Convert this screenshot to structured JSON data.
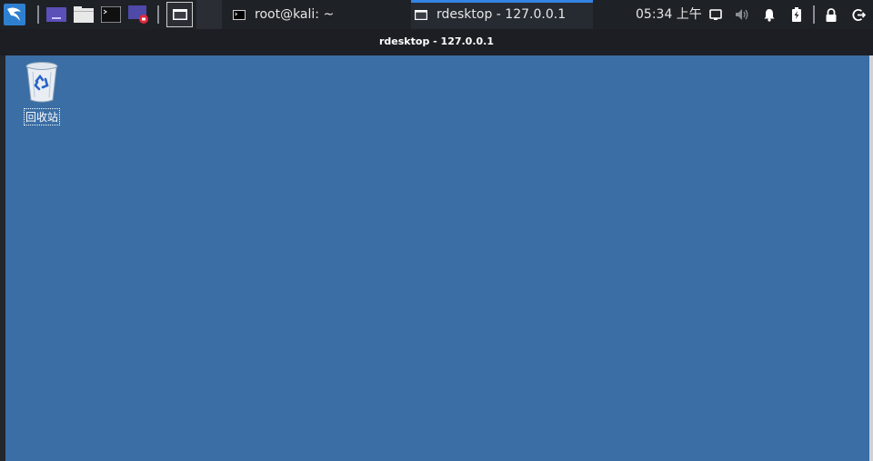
{
  "panel": {
    "launchers": [
      "kali-menu-icon",
      "workspace-icon",
      "file-manager-icon",
      "terminal-icon",
      "screen-recorder-icon",
      "show-desktop-icon"
    ],
    "tasks": [
      {
        "label": "root@kali: ~",
        "active": false
      },
      {
        "label": "rdesktop - 127.0.0.1",
        "active": true
      }
    ],
    "clock": "05:34 上午",
    "tray": [
      "display-icon",
      "volume-icon",
      "bell-icon",
      "battery-icon",
      "lock-icon",
      "logout-icon"
    ],
    "accent": "#3584e4"
  },
  "window": {
    "title": "rdesktop - 127.0.0.1",
    "desktop_color": "#3a6ea5"
  },
  "desktop": {
    "icons": [
      {
        "label": "回收站",
        "icon": "recycle-bin-icon"
      }
    ]
  }
}
